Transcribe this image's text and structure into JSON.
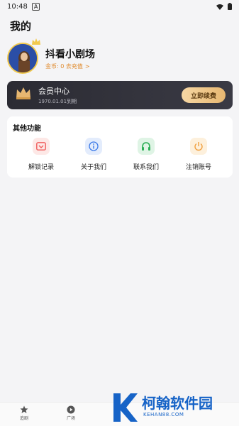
{
  "status_bar": {
    "time": "10:48",
    "notification_glyph": "A"
  },
  "header": {
    "title": "我的"
  },
  "profile": {
    "name": "抖看小剧场",
    "coins_text": "金币: 0 去充值",
    "coins_chevron": ">"
  },
  "vip_card": {
    "title": "会员中心",
    "expiry": "1970.01.01到期",
    "renew_label": "立即续费"
  },
  "features": {
    "title": "其他功能",
    "items": [
      {
        "label": "解锁记录",
        "icon": "unlock-record-icon",
        "color": "#f05b5b"
      },
      {
        "label": "关于我们",
        "icon": "info-icon",
        "color": "#3d7be8"
      },
      {
        "label": "联系我们",
        "icon": "headset-icon",
        "color": "#2cae55"
      },
      {
        "label": "注销账号",
        "icon": "power-icon",
        "color": "#f0a040"
      }
    ]
  },
  "tabbar": {
    "items": [
      {
        "label": "追剧",
        "icon": "star-icon"
      },
      {
        "label": "广场",
        "icon": "play-icon"
      }
    ]
  },
  "watermark": {
    "text": "柯翰软件园",
    "sub": "KEHAN88.COM"
  }
}
